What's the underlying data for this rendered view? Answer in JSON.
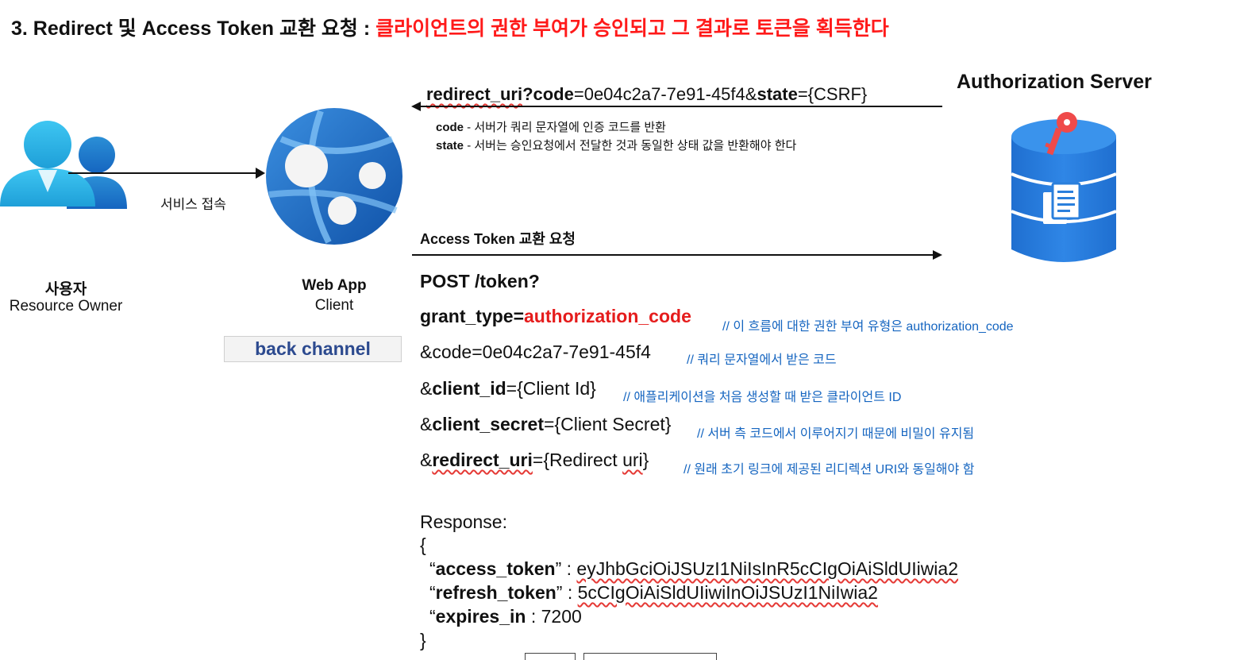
{
  "heading": {
    "prefix": "3. Redirect 및 Access Token 교환 요청 : ",
    "highlight": "클라이언트의 권한 부여가 승인되고 그 결과로 토큰을 획득한다",
    "highlight_color": "#ff1a1a"
  },
  "user": {
    "label_ko": "사용자",
    "label_en": "Resource Owner",
    "icon": "users-icon"
  },
  "user_to_app_label": "서비스 접속",
  "webapp": {
    "title": "Web App",
    "subtitle": "Client",
    "icon": "web-app-globe-icon"
  },
  "back_channel_label": "back channel",
  "auth_server": {
    "title": "Authorization Server",
    "icon": "database-key-icon"
  },
  "redirect": {
    "p1": "redirect_uri",
    "p2": "?code",
    "p3": "=0e04c2a7-7e91-45f4&",
    "p4": "state",
    "p5": "={CSRF}",
    "notes": [
      {
        "key": "code",
        "text": " - 서버가 쿼리 문자열에 인증 코드를 반환"
      },
      {
        "key": "state",
        "text": " - 서버는 승인요청에서 전달한 것과 동일한 상태 값을 반환해야 한다"
      }
    ]
  },
  "exchange_label": "Access Token 교환 요청",
  "request": {
    "post": "POST /token?",
    "grant_key": "grant_type=",
    "grant_val": "authorization_code",
    "grant_comment": "// 이 흐름에 대한 권한 부여 유형은 authorization_code",
    "code_line": "&code=0e04c2a7-7e91-45f4",
    "code_comment": "// 쿼리 문자열에서 받은 코드",
    "client_id_amp": "&",
    "client_id_key": "client_id",
    "client_id_val": "={Client Id}",
    "client_id_comment": "// 애플리케이션을 처음 생성할 때 받은 클라이언트 ID",
    "secret_amp": "&",
    "secret_key": "client_secret",
    "secret_val": "={Client Secret}",
    "secret_comment": "// 서버 측 코드에서 이루어지기 때문에 비밀이 유지됨",
    "redirect_amp": "&",
    "redirect_key": "redirect_uri",
    "redirect_eq": "={Redirect ",
    "redirect_uri_word": "uri",
    "redirect_close": "}",
    "redirect_comment": "// 원래 초기 링크에 제공된 리디렉션 URI와 동일해야 함"
  },
  "response": {
    "title": "Response:",
    "open": "{",
    "fields": [
      {
        "key": "access_token",
        "sep": "” : ",
        "value": "eyJhbGciOiJSUzI1NiIsInR5cCIgOiAiSldUIiwia2"
      },
      {
        "key": "refresh_token",
        "sep": "” : ",
        "value": "5cCIgOiAiSldUIiwiInOiJSUzI1NiIwia2"
      },
      {
        "key": "expires_in",
        "sep": " : ",
        "value": "7200"
      }
    ],
    "close": "}"
  }
}
